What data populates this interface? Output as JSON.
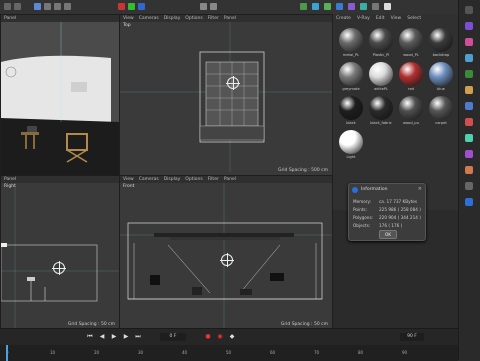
{
  "top_menu": {
    "items": [
      "View",
      "Cameras",
      "Display",
      "Options",
      "Filter",
      "Panel"
    ]
  },
  "viewports": {
    "perspective": {
      "menu": [
        "Panel"
      ],
      "label": ""
    },
    "top": {
      "menu": [
        "View",
        "Cameras",
        "Display",
        "Options",
        "Filter",
        "Panel"
      ],
      "label": "Top",
      "grid_spacing": "Grid Spacing : 500 cm"
    },
    "right": {
      "menu": [
        "Panel"
      ],
      "label": "Right",
      "grid_spacing": "Grid Spacing : 50 cm"
    },
    "front": {
      "menu": [
        "View",
        "Cameras",
        "Display",
        "Options",
        "Filter",
        "Panel"
      ],
      "label": "Front",
      "grid_spacing": "Grid Spacing : 50 cm"
    }
  },
  "materials": {
    "menu": [
      "Create",
      "V-Ray",
      "Edit",
      "View",
      "Select"
    ],
    "items": [
      {
        "label": "metal_PL",
        "color": "#6a6a6a"
      },
      {
        "label": "Plastic_Pl",
        "color": "#4a4a4a"
      },
      {
        "label": "wood_PL",
        "color": "#5a5a5a"
      },
      {
        "label": "backdrop",
        "color": "#3a3a3a"
      },
      {
        "label": "greymate",
        "color": "#7a7a7a"
      },
      {
        "label": "whitePL",
        "color": "#dcdcdc"
      },
      {
        "label": "red",
        "color": "#b03030"
      },
      {
        "label": "blue",
        "color": "#6e8fbf"
      },
      {
        "label": "black",
        "color": "#1e1e1e"
      },
      {
        "label": "black_fabric",
        "color": "#2a2a2a"
      },
      {
        "label": "wood_pu",
        "color": "#4f4f4f"
      },
      {
        "label": "carpet",
        "color": "#555555"
      },
      {
        "label": "Light",
        "color": "#ffffff"
      }
    ]
  },
  "info_dialog": {
    "title": "Information",
    "rows": [
      {
        "label": "Memory:",
        "value": "ca. 17 737 KBytes"
      },
      {
        "label": "Points:",
        "value": "225 986 ( 258 084 )"
      },
      {
        "label": "Polygons:",
        "value": "220 904 ( 344 214 )"
      },
      {
        "label": "Objects:",
        "value": "176 ( 176 )"
      }
    ],
    "ok_label": "OK"
  },
  "timeline": {
    "current_frame": "0 F",
    "ticks": [
      "0",
      "10",
      "20",
      "30",
      "40",
      "50",
      "60",
      "70",
      "80",
      "90"
    ],
    "end_frame": "90 F"
  },
  "colors": {
    "bg": "#2b2b2b",
    "viewport": "#3a3a3a",
    "accent": "#4aa3df"
  }
}
